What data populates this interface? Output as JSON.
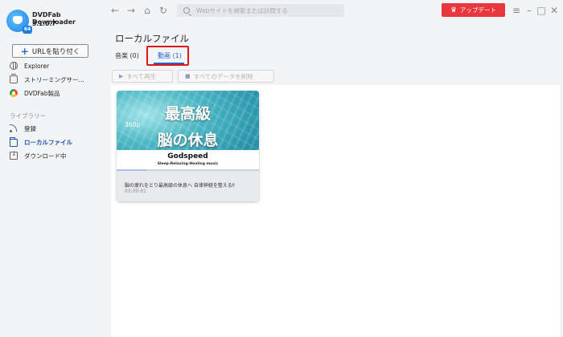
{
  "app": {
    "name": "DVDFab Downloader",
    "version": "3.1.0.7",
    "badge": "64"
  },
  "sidebar": {
    "paste_url_label": "URLを貼り付く",
    "items": [
      {
        "label": "Explorer",
        "icon": "globe-icon"
      },
      {
        "label": "ストリーミングサー...",
        "icon": "streaming-icon"
      },
      {
        "label": "DVDFab製品",
        "icon": "dvdfab-icon"
      }
    ],
    "library_heading": "ライブラリー",
    "library_items": [
      {
        "label": "登録",
        "icon": "rss-icon"
      },
      {
        "label": "ローカルファイル",
        "icon": "folder-icon",
        "active": true
      },
      {
        "label": "ダウンロード中",
        "icon": "download-icon"
      }
    ]
  },
  "topbar": {
    "search_placeholder": "Webサイトを検索または訪問する",
    "upgrade_label": "アップデート",
    "colors": {
      "upgrade": "#e8383e"
    }
  },
  "main": {
    "title": "ローカルファイル",
    "tabs": [
      {
        "label": "音楽 (0)"
      },
      {
        "label": "動画 (1)",
        "selected": true
      }
    ],
    "actions": {
      "play_all": "すべて再生",
      "delete_all": "すべてのデータを削除"
    },
    "videos": [
      {
        "thumb_line1": "最高級",
        "thumb_line2": "脳の休息",
        "resolution": "360p",
        "brand": "Godspeed",
        "subtitle": "Sleep-Relaxing-Healing music",
        "title": "脳の疲れをとり最高級の休息へ 自律神経を整える‼",
        "duration": "03:00:01",
        "progress": 0.21
      }
    ]
  },
  "colors": {
    "accent": "#2563c9",
    "highlight": "#e0151b"
  }
}
